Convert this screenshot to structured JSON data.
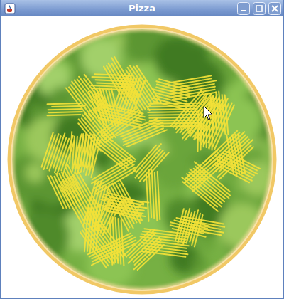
{
  "window": {
    "title": "Pizza"
  }
}
